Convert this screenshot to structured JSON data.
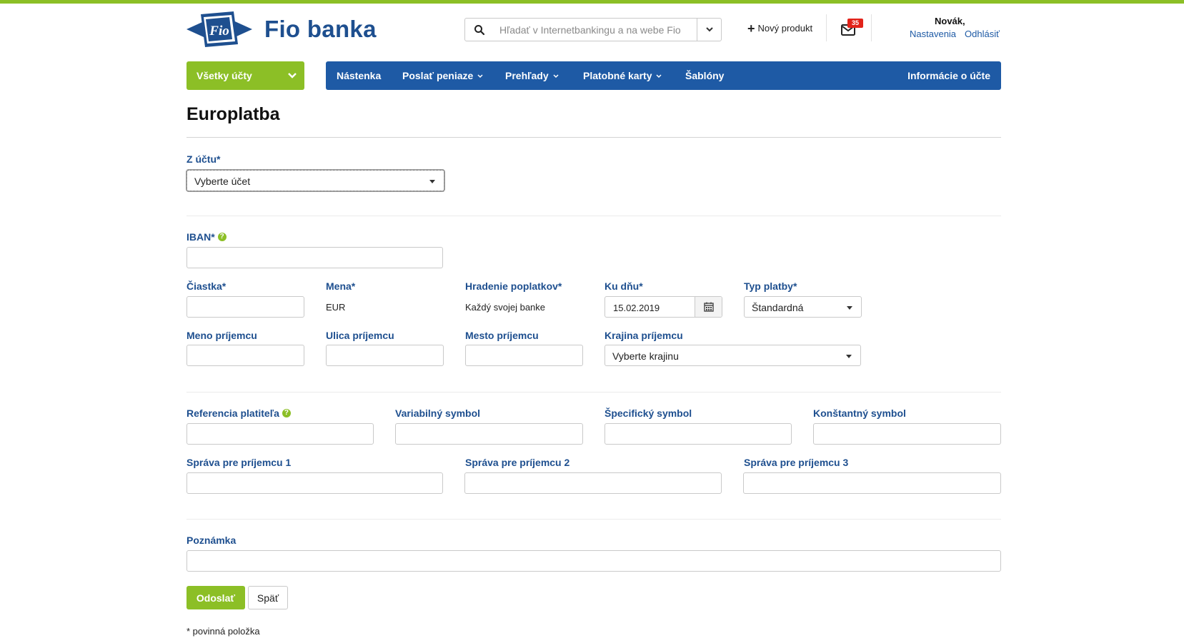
{
  "brand": {
    "name": "Fio banka",
    "logo_text": "Fio",
    "accent": "#8cbf26",
    "primary": "#1e5aa5",
    "logo_blue": "#1e4f8f"
  },
  "header": {
    "search_placeholder": "Hľadať v Internetbankingu a na webe Fio",
    "new_product_label": "Nový produkt",
    "mail_count": "35",
    "user_name": "Novák,",
    "settings_label": "Nastavenia",
    "logout_label": "Odhlásiť"
  },
  "nav": {
    "accounts_label": "Všetky účty",
    "items": [
      {
        "label": "Nástenka"
      },
      {
        "label": "Poslať peniaze"
      },
      {
        "label": "Prehľady"
      },
      {
        "label": "Platobné karty"
      },
      {
        "label": "Šablóny"
      }
    ],
    "info_label": "Informácie o účte"
  },
  "page": {
    "title": "Europlatba"
  },
  "form": {
    "from_account": {
      "label": "Z účtu*",
      "value": "Vyberte účet"
    },
    "iban": {
      "label": "IBAN*",
      "value": ""
    },
    "amount": {
      "label": "Čiastka*",
      "value": ""
    },
    "currency": {
      "label": "Mena*",
      "value": "EUR"
    },
    "fees": {
      "label": "Hradenie poplatkov*",
      "value": "Každý svojej banke"
    },
    "date": {
      "label": "Ku dňu*",
      "value": "15.02.2019"
    },
    "payment_type": {
      "label": "Typ platby*",
      "value": "Štandardná"
    },
    "recipient_name": {
      "label": "Meno príjemcu",
      "value": ""
    },
    "recipient_street": {
      "label": "Ulica príjemcu",
      "value": ""
    },
    "recipient_city": {
      "label": "Mesto príjemcu",
      "value": ""
    },
    "recipient_country": {
      "label": "Krajina príjemcu",
      "value": "Vyberte krajinu"
    },
    "payer_reference": {
      "label": "Referencia platiteľa",
      "value": ""
    },
    "variable_symbol": {
      "label": "Variabilný symbol",
      "value": ""
    },
    "specific_symbol": {
      "label": "Špecifický symbol",
      "value": ""
    },
    "constant_symbol": {
      "label": "Konštantný symbol",
      "value": ""
    },
    "message_1": {
      "label": "Správa pre príjemcu 1",
      "value": ""
    },
    "message_2": {
      "label": "Správa pre príjemcu 2",
      "value": ""
    },
    "message_3": {
      "label": "Správa pre príjemcu 3",
      "value": ""
    },
    "note": {
      "label": "Poznámka",
      "value": ""
    },
    "help_icon_glyph": "?"
  },
  "actions": {
    "send_label": "Odoslať",
    "back_label": "Späť"
  },
  "footnote": "* povinná položka"
}
